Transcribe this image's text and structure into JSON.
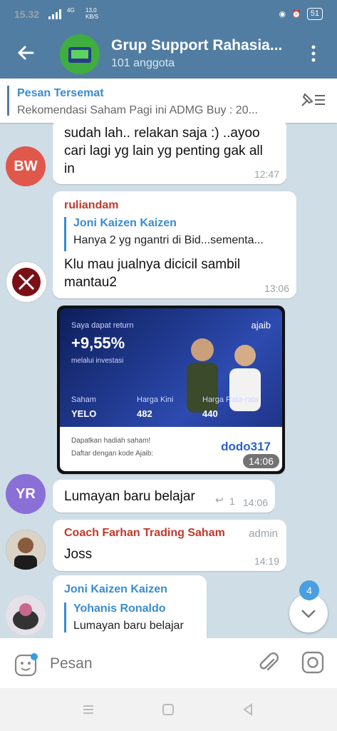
{
  "status": {
    "time": "15.32",
    "net": "4G",
    "speed": "13,0\nKB/S",
    "battery": "51"
  },
  "header": {
    "title": "Grup Support Rahasia...",
    "subtitle": "101 anggota"
  },
  "pinned": {
    "title": "Pesan Tersemat",
    "text": "Rekomendasi Saham Pagi ini  ADMG  Buy : 20..."
  },
  "messages": [
    {
      "avatar_initials": "BW",
      "avatar_color": "#e0574b",
      "text": "sudah lah.. relakan saja :) ..ayoo cari lagi yg lain yg penting gak all in",
      "time": "12:47"
    },
    {
      "sender": "ruliandam",
      "sender_color": "#c0392b",
      "reply_name": "Joni Kaizen Kaizen",
      "reply_text": "Hanya 2 yg ngantri di Bid...sementa...",
      "text": "Klu mau jualnya dicicil sambil mantau2",
      "time": "13:06"
    },
    {
      "image": {
        "line1": "Saya dapat return",
        "return": "+9,55%",
        "line2": "melalui investasi",
        "brand": "ajaib",
        "col1_label": "Saham",
        "col1_value": "YELO",
        "col2_label": "Harga Kini",
        "col2_value": "482",
        "col3_label": "Harga Rata-rata",
        "col3_value": "440",
        "footer1": "Dapatkan hadiah saham!",
        "footer2": "Daftar dengan kode Ajaib:",
        "code": "dodo317"
      },
      "time": "14:06"
    },
    {
      "avatar_initials": "YR",
      "avatar_color": "#8a6fd6",
      "text": "Lumayan baru belajar",
      "reply_count": "1",
      "time": "14:06"
    },
    {
      "sender": "Coach Farhan Trading Saham",
      "sender_color": "#c0392b",
      "role": "admin",
      "text": "Joss",
      "time": "14:19"
    },
    {
      "sender": "Joni Kaizen Kaizen",
      "sender_color": "#3a8ccf",
      "reply_name": "Yohanis Ronaldo",
      "reply_text": "Lumayan baru belajar"
    }
  ],
  "scroll_badge": "4",
  "composer": {
    "placeholder": "Pesan"
  },
  "colors": {
    "header": "#517da2",
    "accent": "#3a8ccf"
  }
}
